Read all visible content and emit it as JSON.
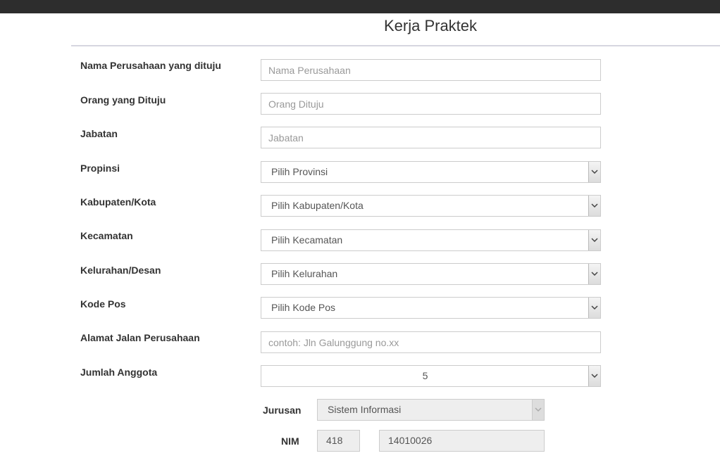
{
  "page": {
    "title": "Kerja Praktek"
  },
  "form": {
    "company_name": {
      "label": "Nama Perusahaan yang dituju",
      "placeholder": "Nama Perusahaan"
    },
    "recipient": {
      "label": "Orang yang Dituju",
      "placeholder": "Orang Dituju"
    },
    "position": {
      "label": "Jabatan",
      "placeholder": "Jabatan"
    },
    "province": {
      "label": "Propinsi",
      "value": "Pilih Provinsi"
    },
    "regency": {
      "label": "Kabupaten/Kota",
      "value": "Pilih Kabupaten/Kota"
    },
    "district": {
      "label": "Kecamatan",
      "value": "Pilih Kecamatan"
    },
    "village": {
      "label": "Kelurahan/Desan",
      "value": "Pilih Kelurahan"
    },
    "postal_code": {
      "label": "Kode Pos",
      "value": "Pilih Kode Pos"
    },
    "address": {
      "label": "Alamat Jalan Perusahaan",
      "placeholder": "contoh: Jln Galunggung no.xx"
    },
    "member_count": {
      "label": "Jumlah Anggota",
      "value": "5"
    },
    "major": {
      "label": "Jurusan",
      "value": "Sistem Informasi"
    },
    "nim": {
      "label": "NIM",
      "prefix": "418",
      "number": "14010026"
    }
  }
}
